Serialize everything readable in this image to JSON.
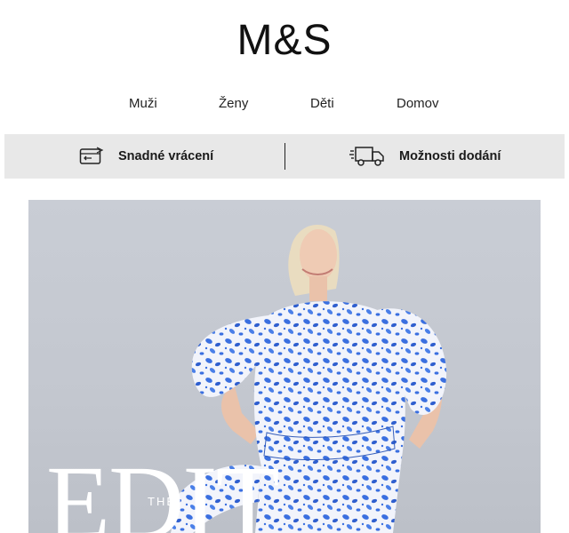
{
  "brand": {
    "logo_text": "M&S"
  },
  "nav": {
    "items": [
      {
        "label": "Muži"
      },
      {
        "label": "Ženy"
      },
      {
        "label": "Děti"
      },
      {
        "label": "Domov"
      }
    ]
  },
  "info_bar": {
    "returns_label": "Snadné vrácení",
    "delivery_label": "Možnosti dodání",
    "returns_icon": "returns-card-icon",
    "delivery_icon": "delivery-truck-icon"
  },
  "hero": {
    "headline": "EDIT",
    "prefix": "THE",
    "colors": {
      "dress": "#3a6fe0",
      "background": "#c6cad2"
    }
  }
}
